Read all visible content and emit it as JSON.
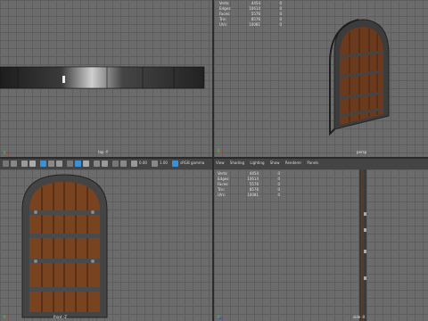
{
  "hud": {
    "rows": [
      {
        "label": "Verts:",
        "v1": "4454",
        "v2": "0"
      },
      {
        "label": "Edges:",
        "v1": "10614",
        "v2": "0"
      },
      {
        "label": "Faces:",
        "v1": "5576",
        "v2": "0"
      },
      {
        "label": "Tris:",
        "v1": "8576",
        "v2": "0"
      },
      {
        "label": "UVs:",
        "v1": "10081",
        "v2": "0"
      }
    ]
  },
  "viewports": {
    "top": "top -Y",
    "persp": "persp",
    "front": "front -Z",
    "side": "side -X"
  },
  "panel_menu": [
    "View",
    "Shading",
    "Lighting",
    "Show",
    "Renderer",
    "Panels"
  ],
  "toolbar": {
    "field1": "0.00",
    "field2": "1.00",
    "colorspace": "sRGB gamma"
  },
  "colors": {
    "viewport_bg": "#6c6c6c",
    "grid": "#5e5e5e",
    "accent_blue": "#3d8fd6",
    "toolbar_bg": "#444444"
  }
}
